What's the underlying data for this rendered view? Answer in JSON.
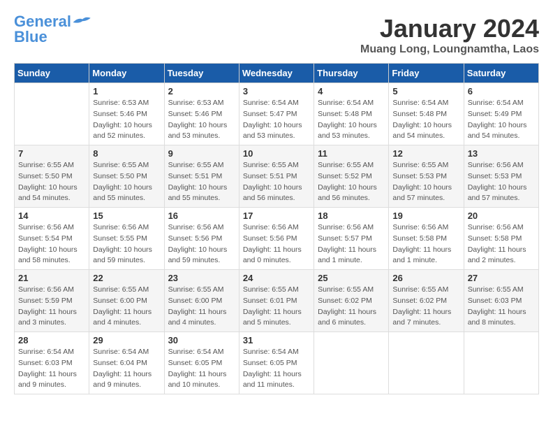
{
  "header": {
    "logo_line1": "General",
    "logo_line2": "Blue",
    "month_title": "January 2024",
    "location": "Muang Long, Loungnamtha, Laos"
  },
  "calendar": {
    "days_of_week": [
      "Sunday",
      "Monday",
      "Tuesday",
      "Wednesday",
      "Thursday",
      "Friday",
      "Saturday"
    ],
    "weeks": [
      [
        {
          "day": "",
          "sunrise": "",
          "sunset": "",
          "daylight": ""
        },
        {
          "day": "1",
          "sunrise": "6:53 AM",
          "sunset": "5:46 PM",
          "daylight": "10 hours and 52 minutes."
        },
        {
          "day": "2",
          "sunrise": "6:53 AM",
          "sunset": "5:46 PM",
          "daylight": "10 hours and 53 minutes."
        },
        {
          "day": "3",
          "sunrise": "6:54 AM",
          "sunset": "5:47 PM",
          "daylight": "10 hours and 53 minutes."
        },
        {
          "day": "4",
          "sunrise": "6:54 AM",
          "sunset": "5:48 PM",
          "daylight": "10 hours and 53 minutes."
        },
        {
          "day": "5",
          "sunrise": "6:54 AM",
          "sunset": "5:48 PM",
          "daylight": "10 hours and 54 minutes."
        },
        {
          "day": "6",
          "sunrise": "6:54 AM",
          "sunset": "5:49 PM",
          "daylight": "10 hours and 54 minutes."
        }
      ],
      [
        {
          "day": "7",
          "sunrise": "6:55 AM",
          "sunset": "5:50 PM",
          "daylight": "10 hours and 54 minutes."
        },
        {
          "day": "8",
          "sunrise": "6:55 AM",
          "sunset": "5:50 PM",
          "daylight": "10 hours and 55 minutes."
        },
        {
          "day": "9",
          "sunrise": "6:55 AM",
          "sunset": "5:51 PM",
          "daylight": "10 hours and 55 minutes."
        },
        {
          "day": "10",
          "sunrise": "6:55 AM",
          "sunset": "5:51 PM",
          "daylight": "10 hours and 56 minutes."
        },
        {
          "day": "11",
          "sunrise": "6:55 AM",
          "sunset": "5:52 PM",
          "daylight": "10 hours and 56 minutes."
        },
        {
          "day": "12",
          "sunrise": "6:55 AM",
          "sunset": "5:53 PM",
          "daylight": "10 hours and 57 minutes."
        },
        {
          "day": "13",
          "sunrise": "6:56 AM",
          "sunset": "5:53 PM",
          "daylight": "10 hours and 57 minutes."
        }
      ],
      [
        {
          "day": "14",
          "sunrise": "6:56 AM",
          "sunset": "5:54 PM",
          "daylight": "10 hours and 58 minutes."
        },
        {
          "day": "15",
          "sunrise": "6:56 AM",
          "sunset": "5:55 PM",
          "daylight": "10 hours and 59 minutes."
        },
        {
          "day": "16",
          "sunrise": "6:56 AM",
          "sunset": "5:56 PM",
          "daylight": "10 hours and 59 minutes."
        },
        {
          "day": "17",
          "sunrise": "6:56 AM",
          "sunset": "5:56 PM",
          "daylight": "11 hours and 0 minutes."
        },
        {
          "day": "18",
          "sunrise": "6:56 AM",
          "sunset": "5:57 PM",
          "daylight": "11 hours and 1 minute."
        },
        {
          "day": "19",
          "sunrise": "6:56 AM",
          "sunset": "5:58 PM",
          "daylight": "11 hours and 1 minute."
        },
        {
          "day": "20",
          "sunrise": "6:56 AM",
          "sunset": "5:58 PM",
          "daylight": "11 hours and 2 minutes."
        }
      ],
      [
        {
          "day": "21",
          "sunrise": "6:56 AM",
          "sunset": "5:59 PM",
          "daylight": "11 hours and 3 minutes."
        },
        {
          "day": "22",
          "sunrise": "6:55 AM",
          "sunset": "6:00 PM",
          "daylight": "11 hours and 4 minutes."
        },
        {
          "day": "23",
          "sunrise": "6:55 AM",
          "sunset": "6:00 PM",
          "daylight": "11 hours and 4 minutes."
        },
        {
          "day": "24",
          "sunrise": "6:55 AM",
          "sunset": "6:01 PM",
          "daylight": "11 hours and 5 minutes."
        },
        {
          "day": "25",
          "sunrise": "6:55 AM",
          "sunset": "6:02 PM",
          "daylight": "11 hours and 6 minutes."
        },
        {
          "day": "26",
          "sunrise": "6:55 AM",
          "sunset": "6:02 PM",
          "daylight": "11 hours and 7 minutes."
        },
        {
          "day": "27",
          "sunrise": "6:55 AM",
          "sunset": "6:03 PM",
          "daylight": "11 hours and 8 minutes."
        }
      ],
      [
        {
          "day": "28",
          "sunrise": "6:54 AM",
          "sunset": "6:03 PM",
          "daylight": "11 hours and 9 minutes."
        },
        {
          "day": "29",
          "sunrise": "6:54 AM",
          "sunset": "6:04 PM",
          "daylight": "11 hours and 9 minutes."
        },
        {
          "day": "30",
          "sunrise": "6:54 AM",
          "sunset": "6:05 PM",
          "daylight": "11 hours and 10 minutes."
        },
        {
          "day": "31",
          "sunrise": "6:54 AM",
          "sunset": "6:05 PM",
          "daylight": "11 hours and 11 minutes."
        },
        {
          "day": "",
          "sunrise": "",
          "sunset": "",
          "daylight": ""
        },
        {
          "day": "",
          "sunrise": "",
          "sunset": "",
          "daylight": ""
        },
        {
          "day": "",
          "sunrise": "",
          "sunset": "",
          "daylight": ""
        }
      ]
    ]
  }
}
